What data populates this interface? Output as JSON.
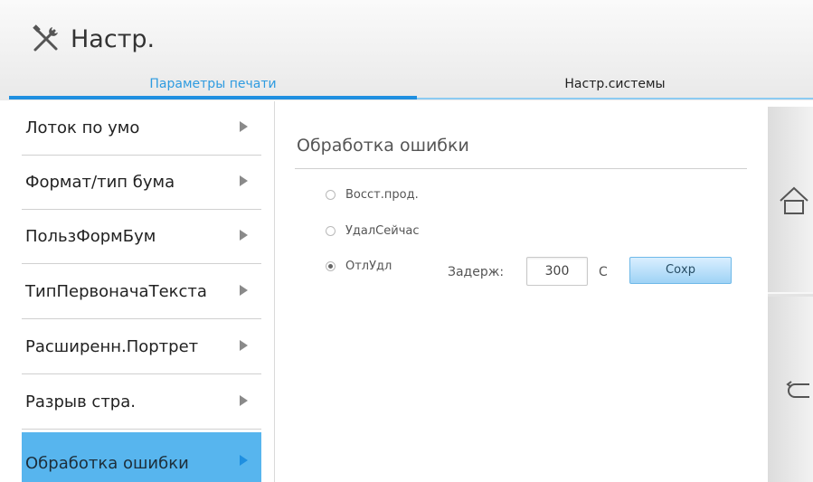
{
  "header": {
    "title": "Настр.",
    "title_icon": "tools-icon"
  },
  "tabs": [
    {
      "label": "Параметры печати",
      "active": true
    },
    {
      "label": "Настр.системы",
      "active": false
    }
  ],
  "menu": {
    "items": [
      {
        "label": "Лоток по умо",
        "active": false
      },
      {
        "label": "Формат/тип бума",
        "active": false
      },
      {
        "label": "ПользФормБум",
        "active": false
      },
      {
        "label": "ТипПервоначаТекста",
        "active": false
      },
      {
        "label": "Расширенн.Портрет",
        "active": false
      },
      {
        "label": "Разрыв стра.",
        "active": false
      },
      {
        "label": "Обработка ошибки",
        "active": true
      }
    ]
  },
  "content": {
    "section_title": "Обработка ошибки",
    "options": [
      {
        "label": "Восст.прод.",
        "checked": false
      },
      {
        "label": "УдалСейчас",
        "checked": false
      },
      {
        "label": "ОтлУдл",
        "checked": true
      }
    ],
    "delay_label": "Задерж:",
    "delay_value": "300",
    "delay_unit": "С",
    "save_label": "Сохр"
  },
  "rail": {
    "top_icon": "home-icon",
    "bottom_icon": "back-icon"
  },
  "colors": {
    "accent": "#1f8fe0",
    "active_item": "#57b5ee"
  }
}
